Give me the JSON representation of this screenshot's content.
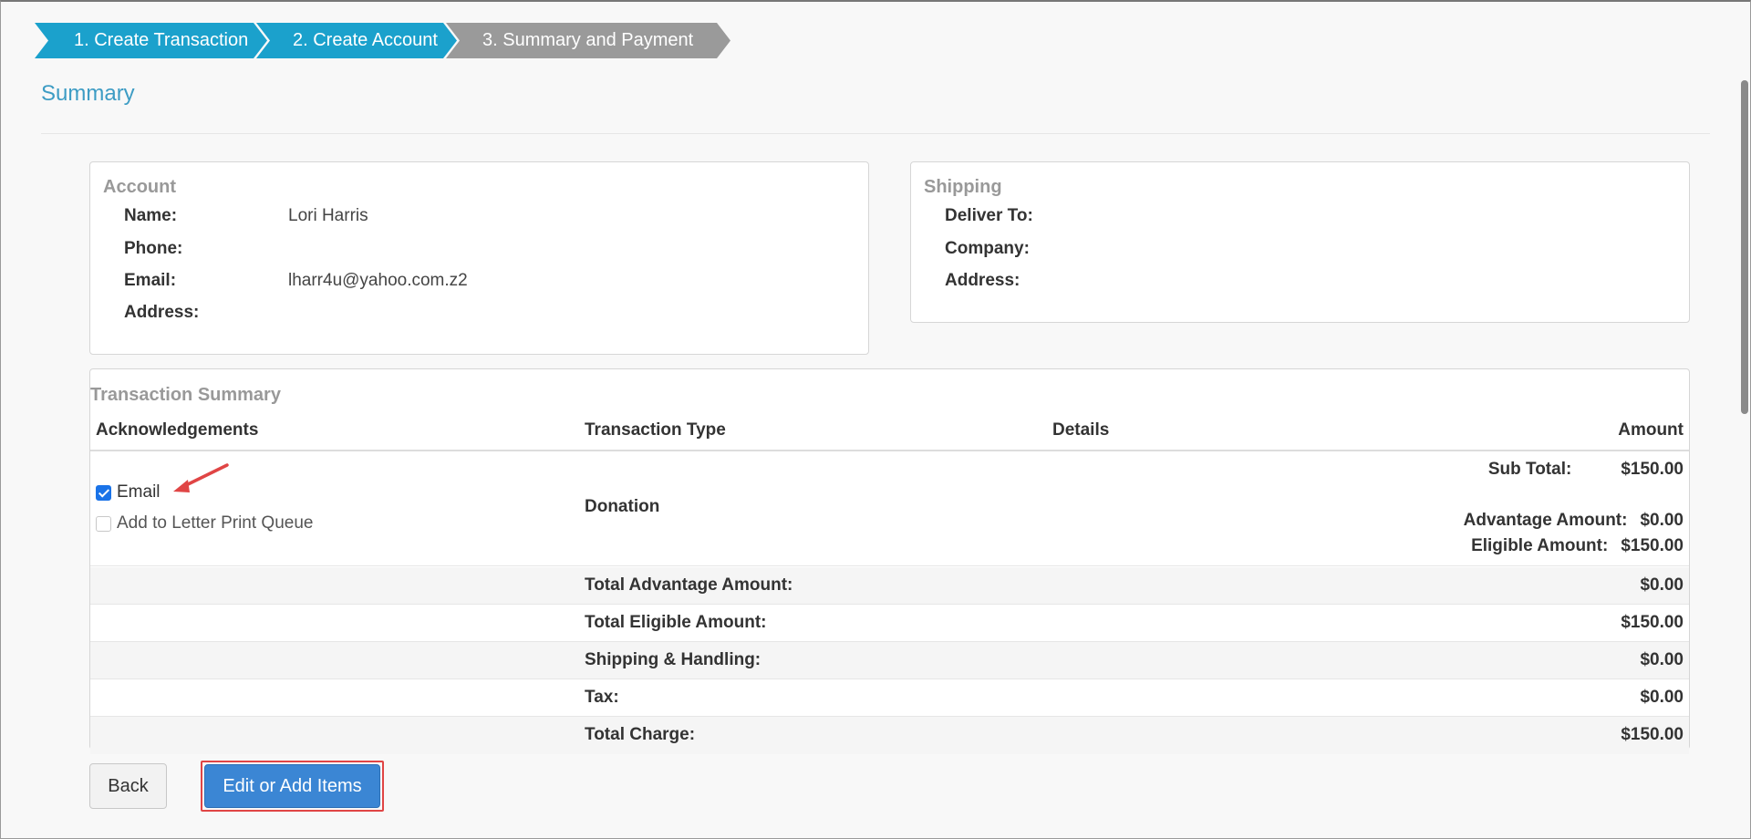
{
  "wizard": {
    "steps": [
      {
        "label": "1. Create Transaction",
        "state": "complete"
      },
      {
        "label": "2. Create Account",
        "state": "complete"
      },
      {
        "label": "3. Summary and Payment",
        "state": "current"
      }
    ]
  },
  "page": {
    "title": "Summary"
  },
  "account": {
    "title": "Account",
    "fields": [
      {
        "label": "Name:",
        "value": "Lori Harris"
      },
      {
        "label": "Phone:",
        "value": ""
      },
      {
        "label": "Email:",
        "value": "lharr4u@yahoo.com.z2"
      },
      {
        "label": "Address:",
        "value": ""
      }
    ]
  },
  "shipping": {
    "title": "Shipping",
    "fields": [
      {
        "label": "Deliver To:",
        "value": ""
      },
      {
        "label": "Company:",
        "value": ""
      },
      {
        "label": "Address:",
        "value": ""
      }
    ]
  },
  "transaction": {
    "title": "Transaction Summary",
    "headers": {
      "acknowledgements": "Acknowledgements",
      "type": "Transaction Type",
      "details": "Details",
      "amount": "Amount"
    },
    "acknowledgements": [
      {
        "label": "Email",
        "checked": true,
        "enabled": true
      },
      {
        "label": "Add to Letter Print Queue",
        "checked": false,
        "enabled": false
      }
    ],
    "line_item": {
      "type": "Donation",
      "sub_total_label": "Sub Total:",
      "sub_total": "$150.00",
      "advantage_label": "Advantage Amount:",
      "advantage": "$0.00",
      "eligible_label": "Eligible Amount:",
      "eligible": "$150.00"
    },
    "totals": [
      {
        "label": "Total Advantage Amount:",
        "amount": "$0.00"
      },
      {
        "label": "Total Eligible Amount:",
        "amount": "$150.00"
      },
      {
        "label": "Shipping & Handling:",
        "amount": "$0.00"
      },
      {
        "label": "Tax:",
        "amount": "$0.00"
      },
      {
        "label": "Total Charge:",
        "amount": "$150.00"
      }
    ]
  },
  "buttons": {
    "back": "Back",
    "edit": "Edit or Add Items"
  },
  "colors": {
    "step_active": "#1ba1cc",
    "step_current": "#9a9a9a",
    "title": "#3d9cc4",
    "primary_button": "#3b86d4",
    "highlight": "#e04545"
  }
}
